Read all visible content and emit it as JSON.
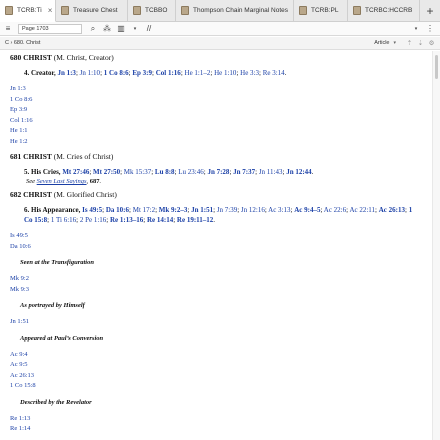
{
  "tabs": [
    {
      "label": "TCRB:Ti",
      "icon": "book-icon",
      "active": true,
      "closable": true
    },
    {
      "label": "Treasure Chest",
      "icon": "book-icon"
    },
    {
      "label": "TCBBO",
      "icon": "book-icon"
    },
    {
      "label": "Thompson Chain Marginal Notes",
      "icon": "book-icon"
    },
    {
      "label": "TCRB:PL",
      "icon": "book-icon"
    },
    {
      "label": "TCRBC:HCCRB",
      "icon": "book-icon"
    }
  ],
  "toolbar": {
    "reference_value": "Page 1703",
    "search_icon": "search-icon",
    "parallel_icon": "parallel-icon",
    "columns_icon": "columns-icon",
    "sync_icon": "sync-icon",
    "menu_icon": "more-icon"
  },
  "breadcrumb": {
    "path": "C › 680. Christ",
    "view": "Article"
  },
  "content": {
    "e680": {
      "num": "680",
      "word": "CHRIST",
      "paren": "(M. Christ, Creator)"
    },
    "e680_sub": {
      "label": "4. Creator,",
      "refs": [
        "Jn 1:3",
        "Jn 1:10",
        "1 Co 8:6",
        "Ep 3:9",
        "Col 1:16",
        "He 1:1–2",
        "He 1:10",
        "He 3:3",
        "Re 3:14"
      ]
    },
    "e680_list": [
      "Jn 1:3",
      "1 Co 8:6",
      "Ep 3:9",
      "Col 1:16",
      "He 1:1",
      "He 1:2"
    ],
    "e681": {
      "num": "681",
      "word": "CHRIST",
      "paren": "(M. Cries of Christ)"
    },
    "e681_sub": {
      "label": "5. His Cries,",
      "refs": [
        "Mt 27:46",
        "Mt 27:50",
        "Mk 15:37",
        "Lu 8:8",
        "Lu 23:46",
        "Jn 7:28",
        "Jn 7:37",
        "Jn 11:43",
        "Jn 12:44"
      ]
    },
    "e681_see": {
      "prefix": "See",
      "link": "Seven Last Sayings",
      "num": "687"
    },
    "e682": {
      "num": "682",
      "word": "CHRIST",
      "paren": "(M. Glorified Christ)"
    },
    "e682_sub": {
      "label": "6. His Appearance,",
      "refs": [
        "Is 49:5",
        "Da 10:6",
        "Mt 17:2",
        "Mk 9:2–3",
        "Jn 1:51",
        "Jn 7:39",
        "Jn 12:16",
        "Ac 3:13",
        "Ac 9:4–5",
        "Ac 22:6",
        "Ac 22:11",
        "Ac 26:13",
        "1 Co 15:8",
        "1 Ti 6:16",
        "2 Pe 1:16",
        "Re 1:13–16",
        "Re 14:14",
        "Re 19:11–12"
      ]
    },
    "e682_list1": [
      "Is 49:5",
      "Da 10:6"
    ],
    "head_transfig": "Seen at the Transfiguration",
    "list_transfig": [
      "Mk 9:2",
      "Mk 9:3"
    ],
    "head_himself": "As portrayed by Himself",
    "list_himself": [
      "Jn 1:51"
    ],
    "head_paul": "Appeared at Paul’s Conversion",
    "list_paul": [
      "Ac 9:4",
      "Ac 9:5",
      "Ac 26:13",
      "1 Co 15:8"
    ],
    "head_revelator": "Described by the Revelator",
    "list_revelator": [
      "Re 1:13",
      "Re 1:14"
    ]
  }
}
